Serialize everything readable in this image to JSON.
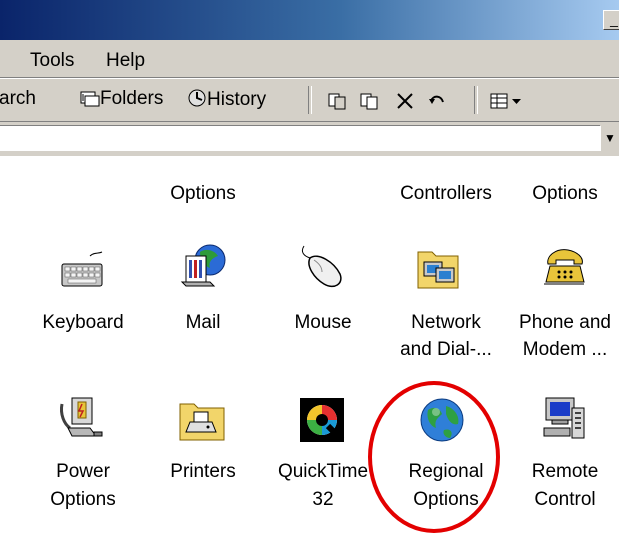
{
  "menu": {
    "tools": "Tools",
    "help": "Help"
  },
  "toolbar": {
    "search_partial": "arch",
    "folders": "Folders",
    "history": "History"
  },
  "top_row_labels": {
    "power_options_line2": "Options",
    "game_controllers_line2": "Controllers",
    "internet_options_line2": "Options"
  },
  "items": [
    {
      "label": "Keyboard",
      "icon": "keyboard-icon"
    },
    {
      "label": "Mail",
      "icon": "mail-icon"
    },
    {
      "label": "Mouse",
      "icon": "mouse-icon"
    },
    {
      "label_line1": "Network",
      "label_line2": "and Dial-...",
      "icon": "network-icon"
    },
    {
      "label_line1": "Phone and",
      "label_line2": "Modem ...",
      "icon": "phone-icon"
    },
    {
      "label_line1": "Power",
      "label_line2": "Options",
      "icon": "power-options-icon"
    },
    {
      "label": "Printers",
      "icon": "printers-icon"
    },
    {
      "label_line1": "QuickTime",
      "label_line2": "32",
      "icon": "quicktime-icon"
    },
    {
      "label_line1": "Regional",
      "label_line2": "Options",
      "icon": "globe-icon"
    },
    {
      "label_line1": "Remote",
      "label_line2": "Control",
      "icon": "remote-control-icon"
    }
  ],
  "colors": {
    "highlight_ring": "#e30000",
    "title_bar": "#0a246a",
    "chrome": "#d4d0c8"
  }
}
